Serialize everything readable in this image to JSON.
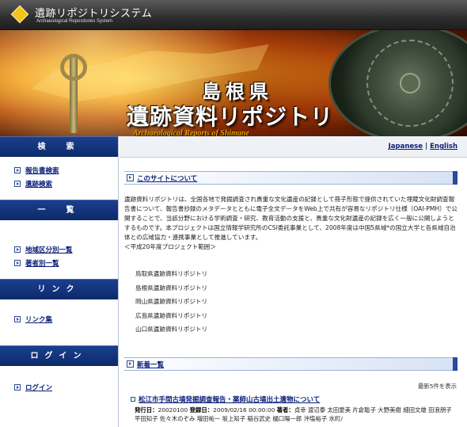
{
  "header": {
    "title": "遺跡リポジトリシステム",
    "subtitle": "Archaeological Repositories System"
  },
  "banner": {
    "line1": "島根県",
    "line2": "遺跡資料リポジトリ",
    "line3": "Archaeological Reports of Shimane"
  },
  "sidebar": {
    "search": {
      "heading": "検　索",
      "links": [
        "報告書検索",
        "遺跡検索"
      ]
    },
    "list": {
      "heading": "一　覧",
      "links": [
        "地域区分別一覧",
        "著者別一覧"
      ]
    },
    "link": {
      "heading": "リンク",
      "links": [
        "リンク集"
      ]
    },
    "login": {
      "heading": "ログイン",
      "links": [
        "ログイン"
      ]
    }
  },
  "lang": {
    "japanese": "Japanese",
    "separator": "|",
    "english": "English"
  },
  "about": {
    "heading": "このサイトについて",
    "body": "遺跡資料リポジトリは、全国各地で発掘調査され貴重な文化遺産の記録として冊子形態で提供されていた埋蔵文化財調査報告書について、報告書抄録のメタデータとともに電子全文データをWeb上で共有が容易なリポジトリ仕様（OAI-PMH）で公開することで、当該分野における学術調査・研究、教育活動の支援と、貴重な文化財遺産の記録を広く一般に公開しようとするものです。本プロジェクトは国立情報学研究所のCSI委託事業として、2008年度は中国5県域*の国立大学と各県域自治体との広域協力・連携事業として推進しています。",
    "note": "＜平成20年度プロジェクト範囲＞",
    "repositories": [
      "鳥取県遺跡資料リポジトリ",
      "島根県遺跡資料リポジトリ",
      "岡山県遺跡資料リポジトリ",
      "広島県遺跡資料リポジトリ",
      "山口県遺跡資料リポジトリ"
    ]
  },
  "news": {
    "heading": "新着一覧",
    "count_text": "最新5件を表示",
    "item_title": "松江市手間古墳発掘調査報告・薬師山古墳出土遺物について",
    "issue_label": "発行日：",
    "issue_value": "20020100",
    "reg_label": "登録日：",
    "reg_value": "2009/02/16 00:00:00",
    "author_label": "著者：",
    "authors": "貞幸 渡辺泰 太田愛美 片倉聡子 大野美樹 細田文雄 田浪朋子 平田知子 佐々木のぞみ 増田祐一 坂上知子 稲谷武史 樋口陽一郎 沖塩裕子 水町/"
  }
}
